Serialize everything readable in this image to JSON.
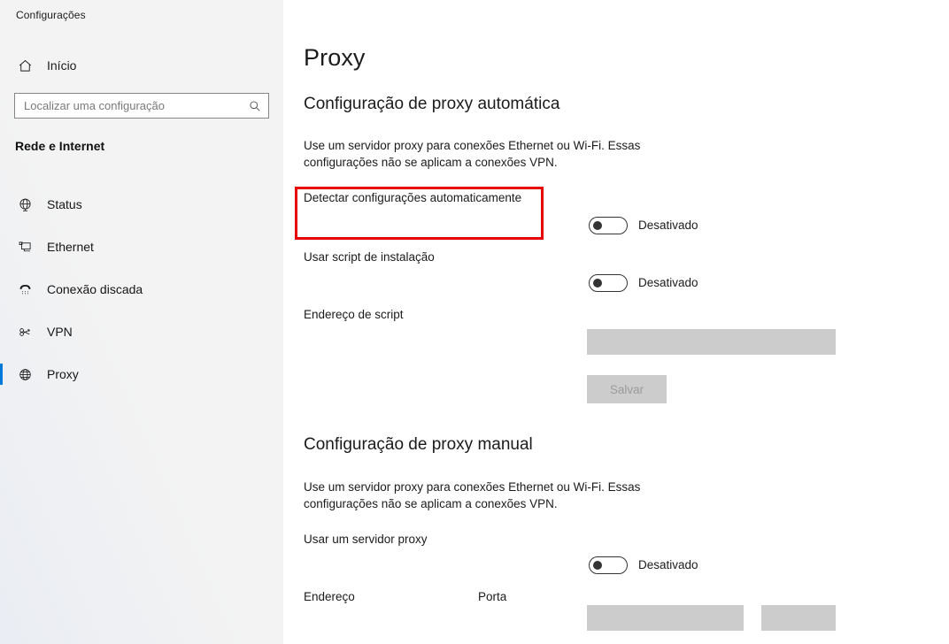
{
  "window": {
    "app_title": "Configurações"
  },
  "sidebar": {
    "home": {
      "label": "Início",
      "icon": "home-icon"
    },
    "search": {
      "placeholder": "Localizar uma configuração",
      "value": "",
      "icon": "search-icon"
    },
    "category": "Rede e Internet",
    "items": [
      {
        "label": "Status",
        "icon": "globe-icon",
        "selected": false
      },
      {
        "label": "Ethernet",
        "icon": "ethernet-icon",
        "selected": false
      },
      {
        "label": "Conexão discada",
        "icon": "dialup-phone-icon",
        "selected": false
      },
      {
        "label": "VPN",
        "icon": "vpn-key-icon",
        "selected": false
      },
      {
        "label": "Proxy",
        "icon": "globe-icon",
        "selected": true
      }
    ]
  },
  "main": {
    "page_title": "Proxy",
    "auto_section": {
      "heading": "Configuração de proxy automática",
      "description": "Use um servidor proxy para conexões Ethernet ou Wi-Fi. Essas configurações não se aplicam a conexões VPN.",
      "detect_label": "Detectar configurações automaticamente",
      "detect_state": "Desativado",
      "script_label": "Usar script de instalação",
      "script_state": "Desativado",
      "script_address_label": "Endereço de script",
      "script_address_value": "",
      "save_label": "Salvar"
    },
    "manual_section": {
      "heading": "Configuração de proxy manual",
      "description": "Use um servidor proxy para conexões Ethernet ou Wi-Fi. Essas configurações não se aplicam a conexões VPN.",
      "use_proxy_label": "Usar um servidor proxy",
      "use_proxy_state": "Desativado",
      "address_label": "Endereço",
      "address_value": "",
      "port_label": "Porta",
      "port_value": ""
    }
  },
  "annotation": {
    "highlight_color": "#e60000",
    "target": "Detectar configurações automaticamente"
  },
  "colors": {
    "accent": "#0078d7",
    "sidebar_bg": "#f3f3f3",
    "content_bg": "#ffffff",
    "disabled_field": "#cccccc",
    "text": "#1b1b1b"
  }
}
